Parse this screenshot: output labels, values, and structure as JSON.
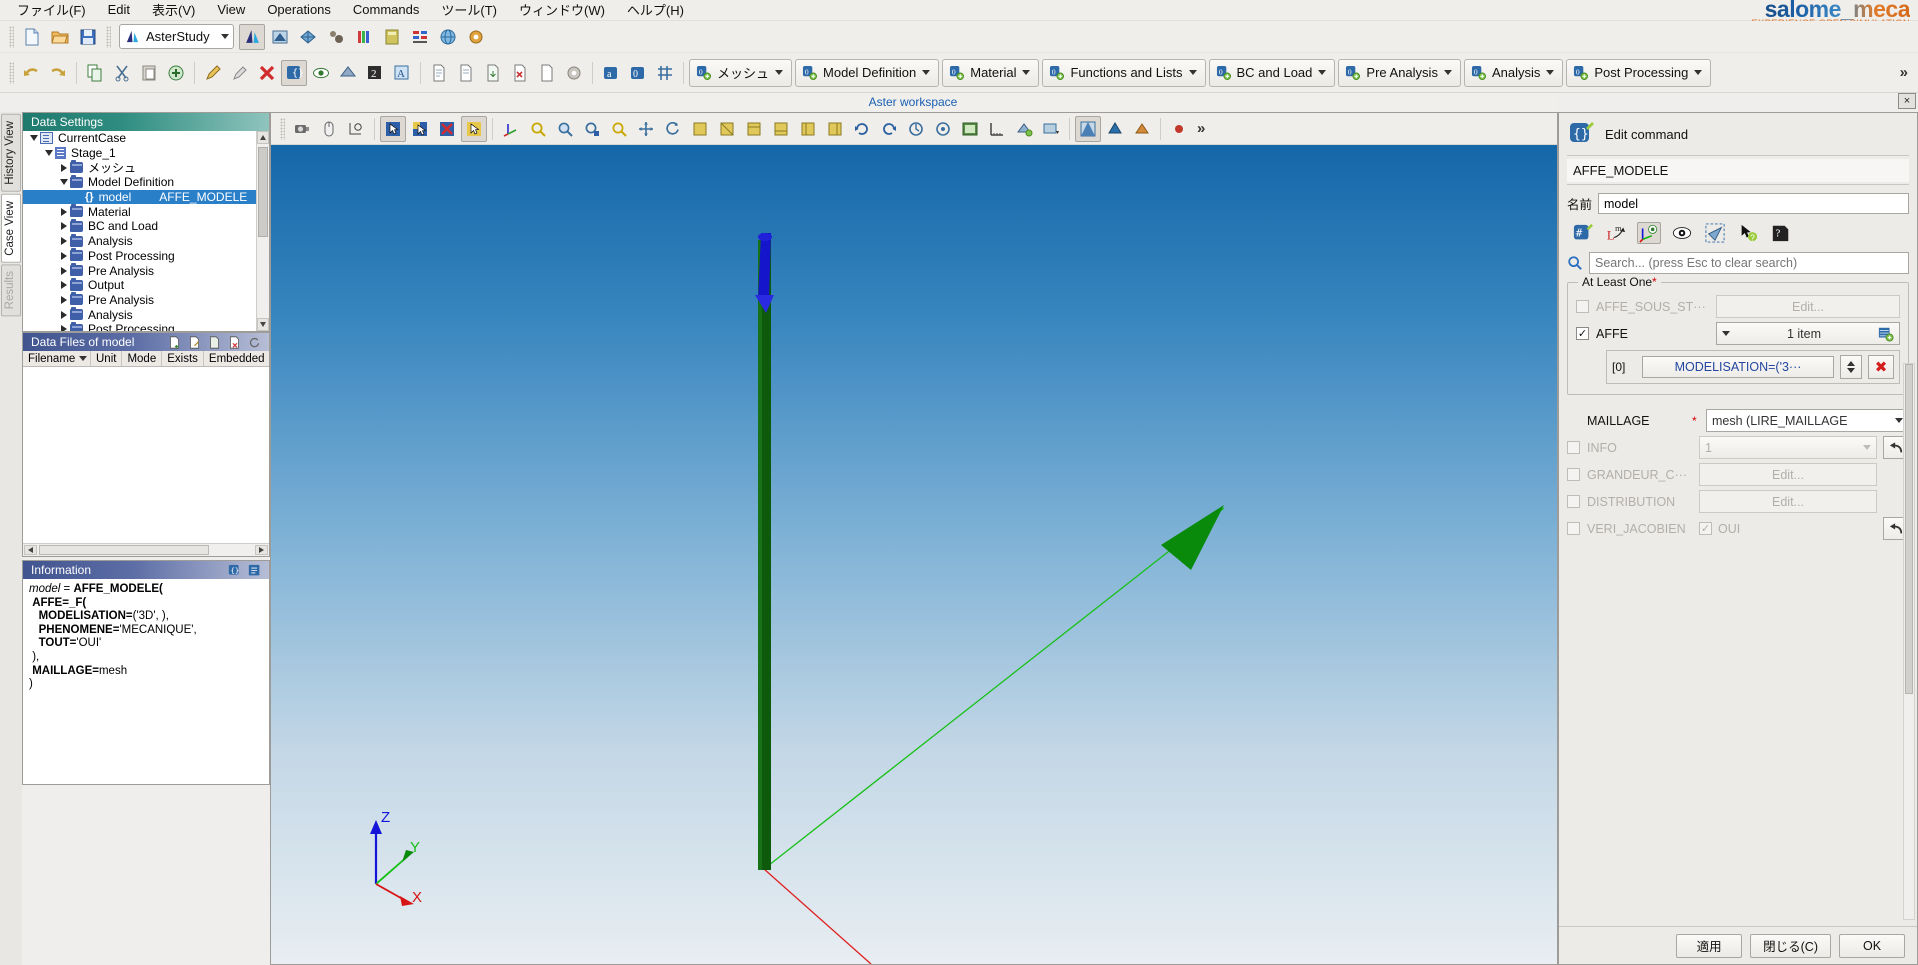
{
  "app": {
    "logo_main": "salome_meca",
    "logo_tagline": "EXPERIENCE OPEN SIMULATION",
    "workspace_title": "Aster workspace",
    "workspace_close": "×"
  },
  "menubar": {
    "items": [
      {
        "label": "ファイル(F)",
        "name": "menu-file"
      },
      {
        "label": "Edit",
        "name": "menu-edit"
      },
      {
        "label": "表示(V)",
        "name": "menu-display"
      },
      {
        "label": "View",
        "name": "menu-view"
      },
      {
        "label": "Operations",
        "name": "menu-operations"
      },
      {
        "label": "Commands",
        "name": "menu-commands"
      },
      {
        "label": "ツール(T)",
        "name": "menu-tools"
      },
      {
        "label": "ウィンドウ(W)",
        "name": "menu-window"
      },
      {
        "label": "ヘルプ(H)",
        "name": "menu-help"
      }
    ]
  },
  "toolbar_main": {
    "study_selector": "AsterStudy",
    "overflow": "»"
  },
  "toolbar_modules": {
    "buttons": [
      {
        "label": "メッシュ",
        "name": "module-mesh"
      },
      {
        "label": "Model Definition",
        "name": "module-model-definition"
      },
      {
        "label": "Material",
        "name": "module-material"
      },
      {
        "label": "Functions and Lists",
        "name": "module-functions-and-lists"
      },
      {
        "label": "BC and Load",
        "name": "module-bc-and-load"
      },
      {
        "label": "Pre Analysis",
        "name": "module-pre-analysis"
      },
      {
        "label": "Analysis",
        "name": "module-analysis"
      },
      {
        "label": "Post Processing",
        "name": "module-post-processing"
      }
    ]
  },
  "vtabs": [
    {
      "label": "History View",
      "name": "vtab-history-view",
      "state": "normal"
    },
    {
      "label": "Case View",
      "name": "vtab-case-view",
      "state": "selected"
    },
    {
      "label": "Results",
      "name": "vtab-results",
      "state": "disabled"
    }
  ],
  "data_settings": {
    "title": "Data Settings",
    "tree": [
      {
        "label": "CurrentCase",
        "indent": 0,
        "twisty": "down",
        "icon": "case",
        "selected": false,
        "value": ""
      },
      {
        "label": "Stage_1",
        "indent": 1,
        "twisty": "down",
        "icon": "doc",
        "selected": false,
        "value": ""
      },
      {
        "label": "メッシュ",
        "indent": 2,
        "twisty": "right",
        "icon": "folder",
        "selected": false,
        "value": ""
      },
      {
        "label": "Model Definition",
        "indent": 2,
        "twisty": "down",
        "icon": "folder",
        "selected": false,
        "value": ""
      },
      {
        "label": "model",
        "indent": 3,
        "twisty": "none",
        "icon": "braces",
        "selected": true,
        "value": "AFFE_MODELE"
      },
      {
        "label": "Material",
        "indent": 2,
        "twisty": "right",
        "icon": "folder",
        "selected": false,
        "value": ""
      },
      {
        "label": "BC and Load",
        "indent": 2,
        "twisty": "right",
        "icon": "folder",
        "selected": false,
        "value": ""
      },
      {
        "label": "Analysis",
        "indent": 2,
        "twisty": "right",
        "icon": "folder",
        "selected": false,
        "value": ""
      },
      {
        "label": "Post Processing",
        "indent": 2,
        "twisty": "right",
        "icon": "folder",
        "selected": false,
        "value": ""
      },
      {
        "label": "Pre Analysis",
        "indent": 2,
        "twisty": "right",
        "icon": "folder",
        "selected": false,
        "value": ""
      },
      {
        "label": "Output",
        "indent": 2,
        "twisty": "right",
        "icon": "folder",
        "selected": false,
        "value": ""
      },
      {
        "label": "Pre Analysis",
        "indent": 2,
        "twisty": "right",
        "icon": "folder",
        "selected": false,
        "value": ""
      },
      {
        "label": "Analysis",
        "indent": 2,
        "twisty": "right",
        "icon": "folder",
        "selected": false,
        "value": ""
      },
      {
        "label": "Post Processing",
        "indent": 2,
        "twisty": "right",
        "icon": "folder",
        "selected": false,
        "value": ""
      }
    ]
  },
  "data_files": {
    "title": "Data Files of model",
    "columns": [
      "Filename",
      "Unit",
      "Mode",
      "Exists",
      "Embedded"
    ],
    "rows": []
  },
  "information": {
    "title": "Information",
    "code_lines": [
      {
        "text": "model",
        "style": "italic"
      },
      {
        "text": " = ",
        "style": "plain"
      },
      {
        "text": "AFFE_MODELE(",
        "style": "bold"
      }
    ],
    "code": "model = AFFE_MODELE(\n AFFE=_F(\n   MODELISATION=('3D', ),\n   PHENOMENE='MECANIQUE',\n   TOUT='OUI'\n ),\n MAILLAGE=mesh\n)"
  },
  "edit_command": {
    "title": "Edit command",
    "command_name": "AFFE_MODELE",
    "name_label": "名前",
    "name_value": "model",
    "search_placeholder": "Search... (press Esc to clear search)",
    "group_title": "At Least One",
    "group_required": "*",
    "params": [
      {
        "name": "AFFE_SOUS_ST···",
        "checked": false,
        "disabled": true,
        "control": "Edit...",
        "control_type": "button",
        "required": false
      },
      {
        "name": "AFFE",
        "checked": true,
        "disabled": false,
        "control": "1 item",
        "control_type": "combo-add",
        "required": false
      }
    ],
    "affe_item": {
      "index": "[0]",
      "value": "MODELISATION=('3···",
      "delete": "✖"
    },
    "params2": [
      {
        "name": "MAILLAGE",
        "checked": null,
        "disabled": false,
        "control": "mesh (LIRE_MAILLAGE",
        "control_type": "combo",
        "required": true
      },
      {
        "name": "INFO",
        "checked": false,
        "disabled": true,
        "control": "1",
        "control_type": "combo",
        "required": false,
        "undo": true
      },
      {
        "name": "GRANDEUR_C···",
        "checked": false,
        "disabled": true,
        "control": "Edit...",
        "control_type": "button",
        "required": false
      },
      {
        "name": "DISTRIBUTION",
        "checked": false,
        "disabled": true,
        "control": "Edit...",
        "control_type": "button",
        "required": false
      },
      {
        "name": "VERI_JACOBIEN",
        "checked": false,
        "disabled": true,
        "control": "OUI",
        "control_type": "checkbox",
        "control_checked": true,
        "required": false,
        "undo": true
      }
    ],
    "buttons": [
      {
        "label": "適用",
        "name": "apply-button"
      },
      {
        "label": "閉じる(C)",
        "name": "close-button"
      },
      {
        "label": "OK",
        "name": "ok-button"
      }
    ]
  },
  "viewport": {
    "axes": {
      "x": "X",
      "y": "Y",
      "z": "Z"
    }
  }
}
